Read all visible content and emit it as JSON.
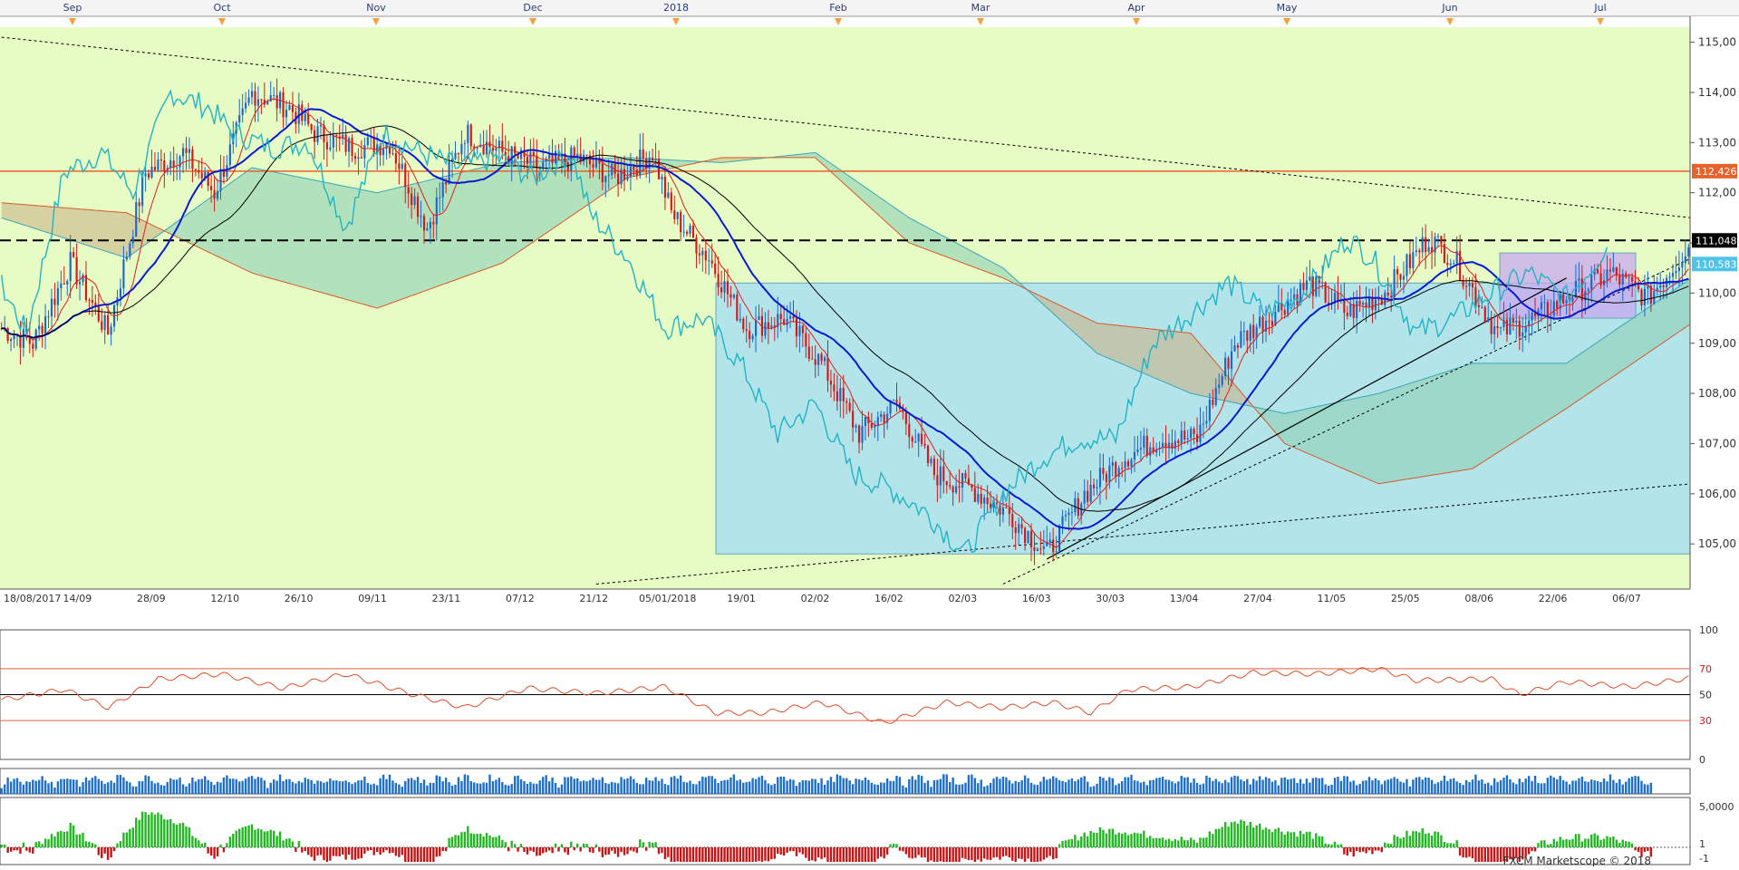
{
  "chart_data": {
    "type": "candlestick",
    "top_month_labels": [
      "Sep",
      "Oct",
      "Nov",
      "Dec",
      "2018",
      "Feb",
      "Mar",
      "Apr",
      "May",
      "Jun",
      "Jul"
    ],
    "price_axis": {
      "ylim": [
        104.1,
        115.3
      ],
      "ticks": [
        "115,00",
        "114,00",
        "113,00",
        "112,00",
        "111,00",
        "110,00",
        "109,00",
        "108,00",
        "107,00",
        "106,00",
        "105,00"
      ]
    },
    "date_axis_labels": [
      "18/08/2017",
      "14/09",
      "28/09",
      "12/10",
      "26/10",
      "09/11",
      "23/11",
      "07/12",
      "21/12",
      "05/01/2018",
      "19/01",
      "02/02",
      "16/02",
      "02/03",
      "16/03",
      "30/03",
      "13/04",
      "27/04",
      "11/05",
      "25/05",
      "08/06",
      "22/06",
      "06/07"
    ],
    "price_labels": [
      {
        "text": "112,426",
        "value": 112.43,
        "color": "#e8622a"
      },
      {
        "text": "111,048",
        "value": 111.05,
        "color": "#000000"
      },
      {
        "text": "110,583",
        "value": 110.58,
        "color": "#4fc3e8"
      }
    ],
    "horizontal_lines": [
      {
        "value": 112.43,
        "style": "solid",
        "color": "#e8622a"
      },
      {
        "value": 111.05,
        "style": "dashed",
        "color": "#000000"
      }
    ],
    "candle_count": 230,
    "candles": {
      "first_close": 109.3,
      "waypoints": [
        [
          0,
          109.3
        ],
        [
          10,
          109.0
        ],
        [
          22,
          110.6
        ],
        [
          34,
          109.2
        ],
        [
          46,
          112.4
        ],
        [
          58,
          112.8
        ],
        [
          68,
          112.0
        ],
        [
          80,
          114.0
        ],
        [
          92,
          113.7
        ],
        [
          100,
          113.2
        ],
        [
          112,
          112.9
        ],
        [
          124,
          113.0
        ],
        [
          136,
          111.3
        ],
        [
          148,
          113.2
        ],
        [
          160,
          112.8
        ],
        [
          172,
          112.5
        ],
        [
          184,
          112.7
        ],
        [
          196,
          112.3
        ],
        [
          208,
          112.8
        ],
        [
          214,
          111.6
        ],
        [
          226,
          110.7
        ],
        [
          238,
          109.3
        ],
        [
          250,
          109.5
        ],
        [
          262,
          108.6
        ],
        [
          274,
          107.2
        ],
        [
          286,
          107.8
        ],
        [
          298,
          106.4
        ],
        [
          310,
          106.1
        ],
        [
          322,
          105.6
        ],
        [
          334,
          104.8
        ],
        [
          346,
          106.0
        ],
        [
          358,
          106.7
        ],
        [
          370,
          107.1
        ],
        [
          382,
          107.1
        ],
        [
          394,
          109.0
        ],
        [
          406,
          109.6
        ],
        [
          418,
          110.2
        ],
        [
          430,
          109.6
        ],
        [
          442,
          110.0
        ],
        [
          456,
          111.1
        ],
        [
          464,
          110.7
        ],
        [
          478,
          109.2
        ],
        [
          490,
          109.5
        ],
        [
          502,
          110.0
        ],
        [
          514,
          110.4
        ],
        [
          526,
          109.9
        ],
        [
          540,
          111.0
        ]
      ]
    },
    "ichimoku_kumo": {
      "span_a": [
        [
          0,
          111.5
        ],
        [
          40,
          110.7
        ],
        [
          80,
          112.5
        ],
        [
          120,
          112.0
        ],
        [
          160,
          112.6
        ],
        [
          200,
          112.7
        ],
        [
          230,
          112.6
        ],
        [
          260,
          112.8
        ],
        [
          290,
          111.5
        ],
        [
          320,
          110.5
        ],
        [
          350,
          108.8
        ],
        [
          380,
          108.0
        ],
        [
          410,
          107.6
        ],
        [
          440,
          108.0
        ],
        [
          470,
          108.6
        ],
        [
          500,
          108.6
        ],
        [
          540,
          110.3
        ]
      ],
      "span_b": [
        [
          0,
          111.8
        ],
        [
          40,
          111.6
        ],
        [
          80,
          110.4
        ],
        [
          120,
          109.7
        ],
        [
          160,
          110.6
        ],
        [
          200,
          112.3
        ],
        [
          230,
          112.7
        ],
        [
          260,
          112.7
        ],
        [
          290,
          111.0
        ],
        [
          320,
          110.3
        ],
        [
          350,
          109.4
        ],
        [
          380,
          109.2
        ],
        [
          410,
          107.0
        ],
        [
          440,
          106.2
        ],
        [
          470,
          106.5
        ],
        [
          500,
          107.7
        ],
        [
          540,
          109.4
        ]
      ]
    },
    "rectangles": [
      {
        "x0_date": "05/01/2018",
        "x1_date": "06/07",
        "top": 110.2,
        "bottom": 104.8,
        "color": "#a8dff0"
      },
      {
        "x0_date": "08/06",
        "x1_date": "06/07",
        "top": 110.8,
        "bottom": 109.5,
        "color": "#c7a8f0"
      }
    ],
    "trend_lines": [
      {
        "from": [
          0,
          115.1
        ],
        "to": [
          540,
          111.5
        ],
        "style": "dotted"
      },
      {
        "from": [
          190,
          104.2
        ],
        "to": [
          540,
          106.2
        ],
        "style": "dotted"
      },
      {
        "from": [
          334,
          104.7
        ],
        "to": [
          500,
          110.3
        ],
        "style": "solid"
      },
      {
        "from": [
          320,
          104.2
        ],
        "to": [
          540,
          110.7
        ],
        "style": "dotted"
      }
    ],
    "rsi": {
      "levels": [
        "100",
        "70",
        "50",
        "30",
        "0"
      ],
      "ylim": [
        0,
        100
      ],
      "waypoints": [
        [
          0,
          46
        ],
        [
          20,
          54
        ],
        [
          34,
          40
        ],
        [
          50,
          62
        ],
        [
          70,
          66
        ],
        [
          90,
          55
        ],
        [
          110,
          66
        ],
        [
          130,
          51
        ],
        [
          148,
          40
        ],
        [
          168,
          55
        ],
        [
          190,
          51
        ],
        [
          212,
          56
        ],
        [
          228,
          36
        ],
        [
          244,
          36
        ],
        [
          262,
          44
        ],
        [
          282,
          28
        ],
        [
          302,
          44
        ],
        [
          320,
          40
        ],
        [
          336,
          44
        ],
        [
          348,
          36
        ],
        [
          360,
          54
        ],
        [
          380,
          56
        ],
        [
          400,
          67
        ],
        [
          420,
          66
        ],
        [
          440,
          70
        ],
        [
          452,
          61
        ],
        [
          476,
          62
        ],
        [
          485,
          50
        ],
        [
          500,
          60
        ],
        [
          520,
          56
        ],
        [
          540,
          63
        ]
      ]
    },
    "volume_panel": {
      "bar_color": "#1e6fc9"
    },
    "histogram_panel": {
      "ticks": [
        "5,0000",
        "1",
        "-1"
      ],
      "positive_color": "#22b822",
      "negative_color": "#c81414"
    },
    "footer": "FXCM Marketscope © 2018"
  }
}
